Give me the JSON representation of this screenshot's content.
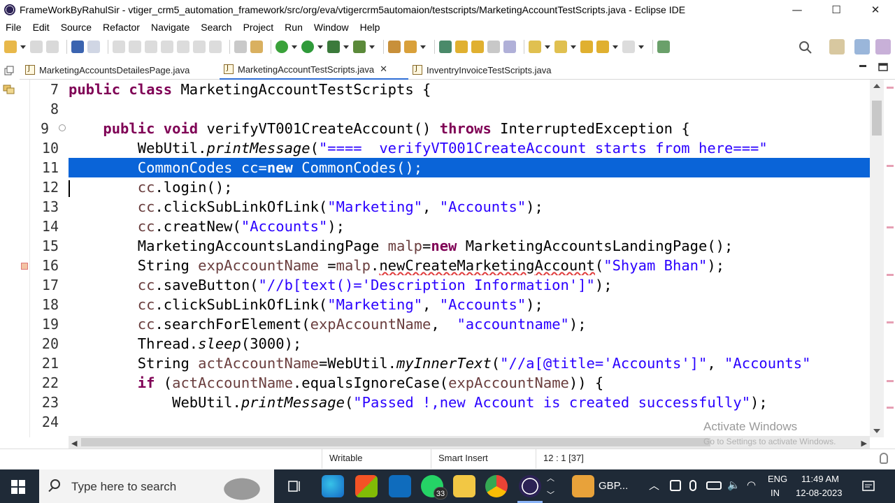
{
  "window": {
    "title": "FrameWorkByRahulSir - vtiger_crm5_automation_framework/src/org/eva/vtigercrm5automaion/testscripts/MarketingAccountTestScripts.java - Eclipse IDE",
    "minimize": "—",
    "maximize": "☐",
    "close": "✕"
  },
  "menu": [
    "File",
    "Edit",
    "Source",
    "Refactor",
    "Navigate",
    "Search",
    "Project",
    "Run",
    "Window",
    "Help"
  ],
  "tabs": [
    {
      "label": "MarketingAccountsDetailesPage.java",
      "active": false
    },
    {
      "label": "MarketingAccountTestScripts.java",
      "active": true,
      "close": "✕"
    },
    {
      "label": "InventryInvoiceTestScripts.java",
      "active": false
    }
  ],
  "editor": {
    "line_numbers": [
      "7",
      "8",
      "9",
      "10",
      "11",
      "12",
      "13",
      "14",
      "15",
      "16",
      "17",
      "18",
      "19",
      "20",
      "21",
      "22",
      "23",
      "24"
    ],
    "selected_line": "11",
    "cursor_line": "12"
  },
  "status": {
    "writable": "Writable",
    "insert_mode": "Smart Insert",
    "position": "12 : 1 [37]"
  },
  "watermark": {
    "line1": "Activate Windows",
    "line2": "Go to Settings to activate Windows."
  },
  "taskbar": {
    "search_placeholder": "Type here to search",
    "whatsapp_badge": "33",
    "weather_text": "GBP...",
    "lang": "ENG",
    "region": "IN",
    "time": "11:49 AM",
    "date": "12-08-2023"
  },
  "colors": {
    "selection": "#0a64d8",
    "keyword": "#7f0055",
    "string": "#2a00ff",
    "taskbar": "#1f2a37"
  }
}
